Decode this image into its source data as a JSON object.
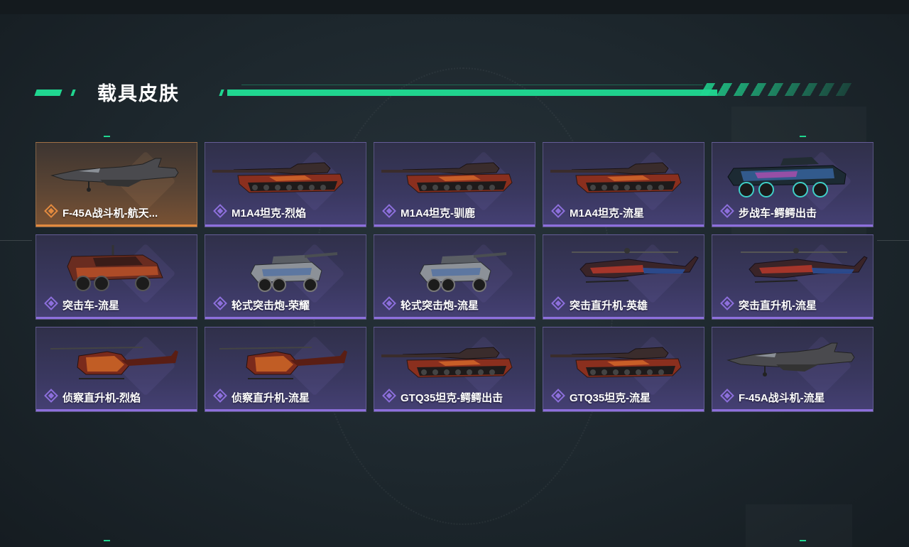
{
  "section": {
    "title": "载具皮肤"
  },
  "colors": {
    "accent": "#20d690",
    "epic": "#8d6fdc",
    "legendary": "#e28a3f"
  },
  "skins": [
    {
      "label": "F-45A战斗机-航天...",
      "rarity": "legendary",
      "icon": "jet-icon"
    },
    {
      "label": "M1A4坦克-烈焰",
      "rarity": "epic",
      "icon": "tank-icon"
    },
    {
      "label": "M1A4坦克-驯鹿",
      "rarity": "epic",
      "icon": "tank-icon"
    },
    {
      "label": "M1A4坦克-流星",
      "rarity": "epic",
      "icon": "tank-icon"
    },
    {
      "label": "步战车-鳄鳄出击",
      "rarity": "epic",
      "icon": "ifv-icon"
    },
    {
      "label": "突击车-流星",
      "rarity": "epic",
      "icon": "assault-vehicle-icon"
    },
    {
      "label": "轮式突击炮-荣耀",
      "rarity": "epic",
      "icon": "wheeled-gun-icon"
    },
    {
      "label": "轮式突击炮-流星",
      "rarity": "epic",
      "icon": "wheeled-gun-icon"
    },
    {
      "label": "突击直升机-英雄",
      "rarity": "epic",
      "icon": "attack-helicopter-icon"
    },
    {
      "label": "突击直升机-流星",
      "rarity": "epic",
      "icon": "attack-helicopter-icon"
    },
    {
      "label": "侦察直升机-烈焰",
      "rarity": "epic",
      "icon": "scout-helicopter-icon"
    },
    {
      "label": "侦察直升机-流星",
      "rarity": "epic",
      "icon": "scout-helicopter-icon"
    },
    {
      "label": "GTQ35坦克-鳄鳄出击",
      "rarity": "epic",
      "icon": "tank-icon"
    },
    {
      "label": "GTQ35坦克-流星",
      "rarity": "epic",
      "icon": "tank-icon"
    },
    {
      "label": "F-45A战斗机-流星",
      "rarity": "epic",
      "icon": "jet-icon"
    }
  ]
}
